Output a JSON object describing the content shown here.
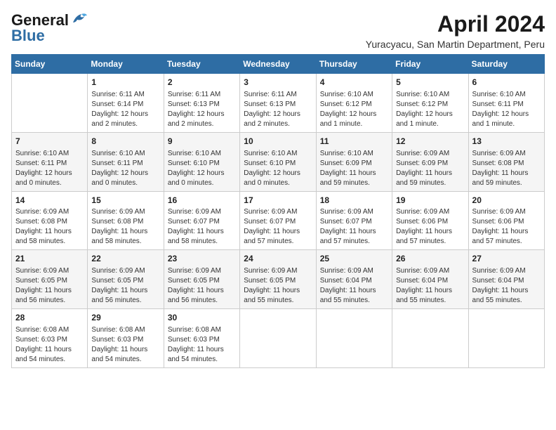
{
  "logo": {
    "line1": "General",
    "line2": "Blue"
  },
  "title": "April 2024",
  "subtitle": "Yuracyacu, San Martin Department, Peru",
  "days_of_week": [
    "Sunday",
    "Monday",
    "Tuesday",
    "Wednesday",
    "Thursday",
    "Friday",
    "Saturday"
  ],
  "weeks": [
    [
      {
        "day": "",
        "info": ""
      },
      {
        "day": "1",
        "info": "Sunrise: 6:11 AM\nSunset: 6:14 PM\nDaylight: 12 hours\nand 2 minutes."
      },
      {
        "day": "2",
        "info": "Sunrise: 6:11 AM\nSunset: 6:13 PM\nDaylight: 12 hours\nand 2 minutes."
      },
      {
        "day": "3",
        "info": "Sunrise: 6:11 AM\nSunset: 6:13 PM\nDaylight: 12 hours\nand 2 minutes."
      },
      {
        "day": "4",
        "info": "Sunrise: 6:10 AM\nSunset: 6:12 PM\nDaylight: 12 hours\nand 1 minute."
      },
      {
        "day": "5",
        "info": "Sunrise: 6:10 AM\nSunset: 6:12 PM\nDaylight: 12 hours\nand 1 minute."
      },
      {
        "day": "6",
        "info": "Sunrise: 6:10 AM\nSunset: 6:11 PM\nDaylight: 12 hours\nand 1 minute."
      }
    ],
    [
      {
        "day": "7",
        "info": "Sunrise: 6:10 AM\nSunset: 6:11 PM\nDaylight: 12 hours\nand 0 minutes."
      },
      {
        "day": "8",
        "info": "Sunrise: 6:10 AM\nSunset: 6:11 PM\nDaylight: 12 hours\nand 0 minutes."
      },
      {
        "day": "9",
        "info": "Sunrise: 6:10 AM\nSunset: 6:10 PM\nDaylight: 12 hours\nand 0 minutes."
      },
      {
        "day": "10",
        "info": "Sunrise: 6:10 AM\nSunset: 6:10 PM\nDaylight: 12 hours\nand 0 minutes."
      },
      {
        "day": "11",
        "info": "Sunrise: 6:10 AM\nSunset: 6:09 PM\nDaylight: 11 hours\nand 59 minutes."
      },
      {
        "day": "12",
        "info": "Sunrise: 6:09 AM\nSunset: 6:09 PM\nDaylight: 11 hours\nand 59 minutes."
      },
      {
        "day": "13",
        "info": "Sunrise: 6:09 AM\nSunset: 6:08 PM\nDaylight: 11 hours\nand 59 minutes."
      }
    ],
    [
      {
        "day": "14",
        "info": "Sunrise: 6:09 AM\nSunset: 6:08 PM\nDaylight: 11 hours\nand 58 minutes."
      },
      {
        "day": "15",
        "info": "Sunrise: 6:09 AM\nSunset: 6:08 PM\nDaylight: 11 hours\nand 58 minutes."
      },
      {
        "day": "16",
        "info": "Sunrise: 6:09 AM\nSunset: 6:07 PM\nDaylight: 11 hours\nand 58 minutes."
      },
      {
        "day": "17",
        "info": "Sunrise: 6:09 AM\nSunset: 6:07 PM\nDaylight: 11 hours\nand 57 minutes."
      },
      {
        "day": "18",
        "info": "Sunrise: 6:09 AM\nSunset: 6:07 PM\nDaylight: 11 hours\nand 57 minutes."
      },
      {
        "day": "19",
        "info": "Sunrise: 6:09 AM\nSunset: 6:06 PM\nDaylight: 11 hours\nand 57 minutes."
      },
      {
        "day": "20",
        "info": "Sunrise: 6:09 AM\nSunset: 6:06 PM\nDaylight: 11 hours\nand 57 minutes."
      }
    ],
    [
      {
        "day": "21",
        "info": "Sunrise: 6:09 AM\nSunset: 6:05 PM\nDaylight: 11 hours\nand 56 minutes."
      },
      {
        "day": "22",
        "info": "Sunrise: 6:09 AM\nSunset: 6:05 PM\nDaylight: 11 hours\nand 56 minutes."
      },
      {
        "day": "23",
        "info": "Sunrise: 6:09 AM\nSunset: 6:05 PM\nDaylight: 11 hours\nand 56 minutes."
      },
      {
        "day": "24",
        "info": "Sunrise: 6:09 AM\nSunset: 6:05 PM\nDaylight: 11 hours\nand 55 minutes."
      },
      {
        "day": "25",
        "info": "Sunrise: 6:09 AM\nSunset: 6:04 PM\nDaylight: 11 hours\nand 55 minutes."
      },
      {
        "day": "26",
        "info": "Sunrise: 6:09 AM\nSunset: 6:04 PM\nDaylight: 11 hours\nand 55 minutes."
      },
      {
        "day": "27",
        "info": "Sunrise: 6:09 AM\nSunset: 6:04 PM\nDaylight: 11 hours\nand 55 minutes."
      }
    ],
    [
      {
        "day": "28",
        "info": "Sunrise: 6:08 AM\nSunset: 6:03 PM\nDaylight: 11 hours\nand 54 minutes."
      },
      {
        "day": "29",
        "info": "Sunrise: 6:08 AM\nSunset: 6:03 PM\nDaylight: 11 hours\nand 54 minutes."
      },
      {
        "day": "30",
        "info": "Sunrise: 6:08 AM\nSunset: 6:03 PM\nDaylight: 11 hours\nand 54 minutes."
      },
      {
        "day": "",
        "info": ""
      },
      {
        "day": "",
        "info": ""
      },
      {
        "day": "",
        "info": ""
      },
      {
        "day": "",
        "info": ""
      }
    ]
  ]
}
